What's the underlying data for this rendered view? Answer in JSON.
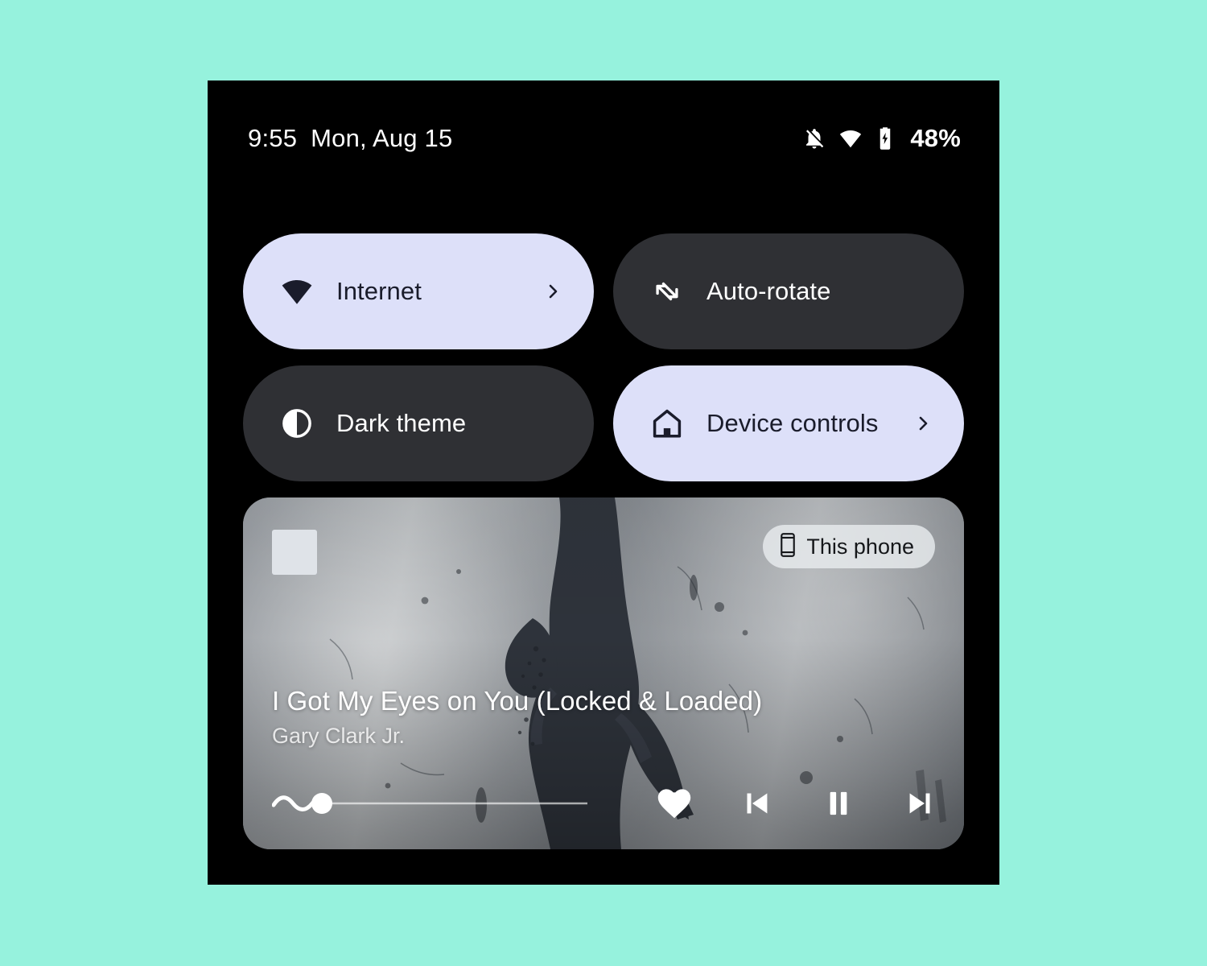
{
  "canvas": {
    "background_color": "#96f2dd"
  },
  "phone": {
    "background_color": "#000000",
    "status_bar": {
      "time": "9:55",
      "date": "Mon, Aug 15",
      "icons": [
        "notifications-off-icon",
        "wifi-icon",
        "battery-charging-icon"
      ],
      "battery_percent": "48%"
    },
    "quick_settings": {
      "active_color": "#dde0f9",
      "inactive_color": "#2f3034",
      "tiles": [
        {
          "label": "Internet",
          "icon": "wifi-icon",
          "state": "active",
          "has_chevron": true
        },
        {
          "label": "Auto-rotate",
          "icon": "auto-rotate-icon",
          "state": "inactive",
          "has_chevron": false
        },
        {
          "label": "Dark theme",
          "icon": "contrast-icon",
          "state": "inactive",
          "has_chevron": false
        },
        {
          "label": "Device controls",
          "icon": "home-icon",
          "state": "active",
          "has_chevron": true
        }
      ]
    },
    "media_player": {
      "app_icon": "app-icon-placeholder",
      "output_chip": {
        "label": "This phone",
        "icon": "phone-icon"
      },
      "title": "I Got My Eyes on You (Locked & Loaded)",
      "artist": "Gary Clark Jr.",
      "progress": {
        "percent": 15,
        "style": "squiggly-wave"
      },
      "controls": [
        {
          "name": "favorite",
          "icon": "heart-filled-icon"
        },
        {
          "name": "previous",
          "icon": "skip-previous-icon"
        },
        {
          "name": "play-pause",
          "icon": "pause-icon"
        },
        {
          "name": "next",
          "icon": "skip-next-icon"
        }
      ]
    }
  }
}
